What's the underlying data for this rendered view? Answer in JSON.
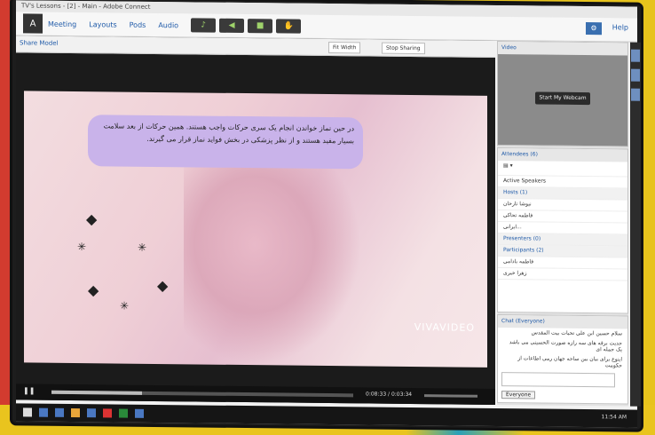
{
  "app": {
    "title": "TV's Lessons - [2] - Main - Adobe Connect",
    "menu": [
      "Meeting",
      "Layouts",
      "Pods",
      "Audio"
    ],
    "help": "Help"
  },
  "share_pod": {
    "title": "Share Model",
    "controls": [
      "Fit Width",
      "Stop Sharing"
    ],
    "caption": "در حین نماز خواندن انجام یک سری حرکات واجب هستند. همین حرکات از بعد سلامت بسیار مفید هستند و از نظر پزشکی در بخش فواید نماز قرار می گیرند.",
    "watermark": "VIVAVIDEO",
    "time": "0:08:33 / 0:03:34"
  },
  "video_pod": {
    "title": "Video",
    "button": "Start My Webcam"
  },
  "attendees_pod": {
    "title": "Attendees (6)",
    "search": "Active Speakers",
    "groups": [
      {
        "name": "Hosts (1)",
        "items": [
          "نیوشا تارخان",
          "فاطمه تحاکی",
          "ایرانی..."
        ]
      },
      {
        "name": "Presenters (0)",
        "items": []
      },
      {
        "name": "Participants (2)",
        "items": [
          "فاطمه بادامی",
          "زهرا خیری"
        ]
      }
    ]
  },
  "chat_pod": {
    "title": "Chat (Everyone)",
    "lines": [
      "سلام حسین ابن علی تحیات بیت المقدس",
      "حدیث برقه های سه رازه صورت الحسینی می باشد یک جمله ای",
      "اینوع برای بیان بین ساحه جهان رمی اطاعات از حکومت"
    ],
    "tab": "Everyone"
  },
  "taskbar": {
    "clock": "11:54 AM"
  },
  "colors": {
    "bg": "#e7c31c",
    "caption": "#c9b3ea",
    "accent": "#1f5aa8"
  }
}
